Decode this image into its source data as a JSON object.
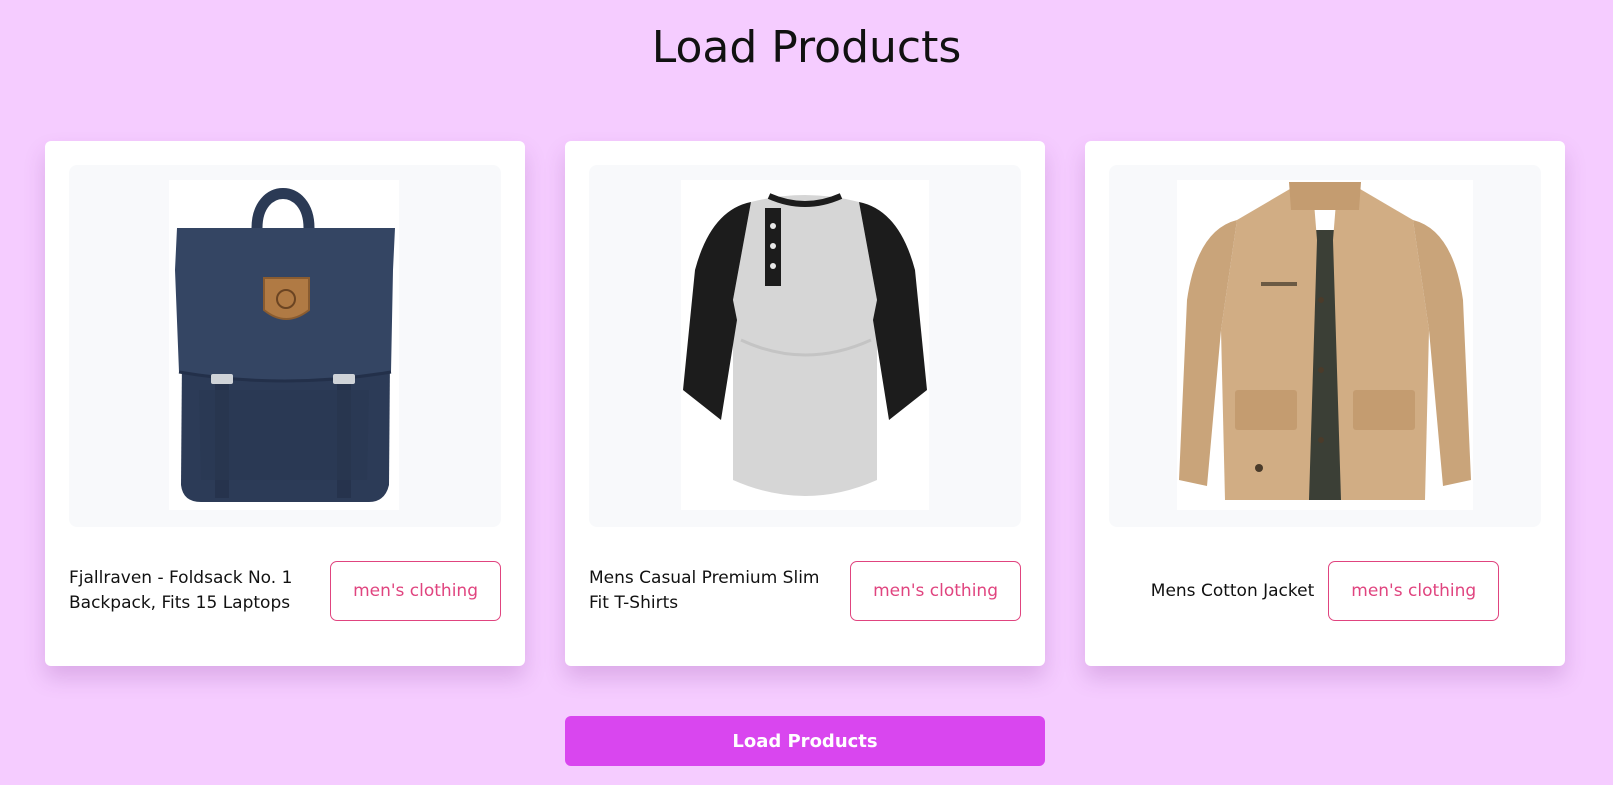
{
  "page": {
    "title": "Load Products"
  },
  "products": [
    {
      "title": "Fjallraven - Foldsack No. 1 Backpack, Fits 15 Laptops",
      "category": "men's clothing",
      "image": "navy-backpack-image"
    },
    {
      "title": "Mens Casual Premium Slim Fit T-Shirts",
      "category": "men's clothing",
      "image": "raglan-henley-tshirt-image"
    },
    {
      "title": "Mens Cotton Jacket",
      "category": "men's clothing",
      "image": "khaki-cotton-jacket-image"
    }
  ],
  "actions": {
    "load_button_label": "Load Products"
  },
  "colors": {
    "background": "#f5ccff",
    "accent_button": "#d946ef",
    "badge": "#e0447f",
    "card": "#ffffff"
  }
}
